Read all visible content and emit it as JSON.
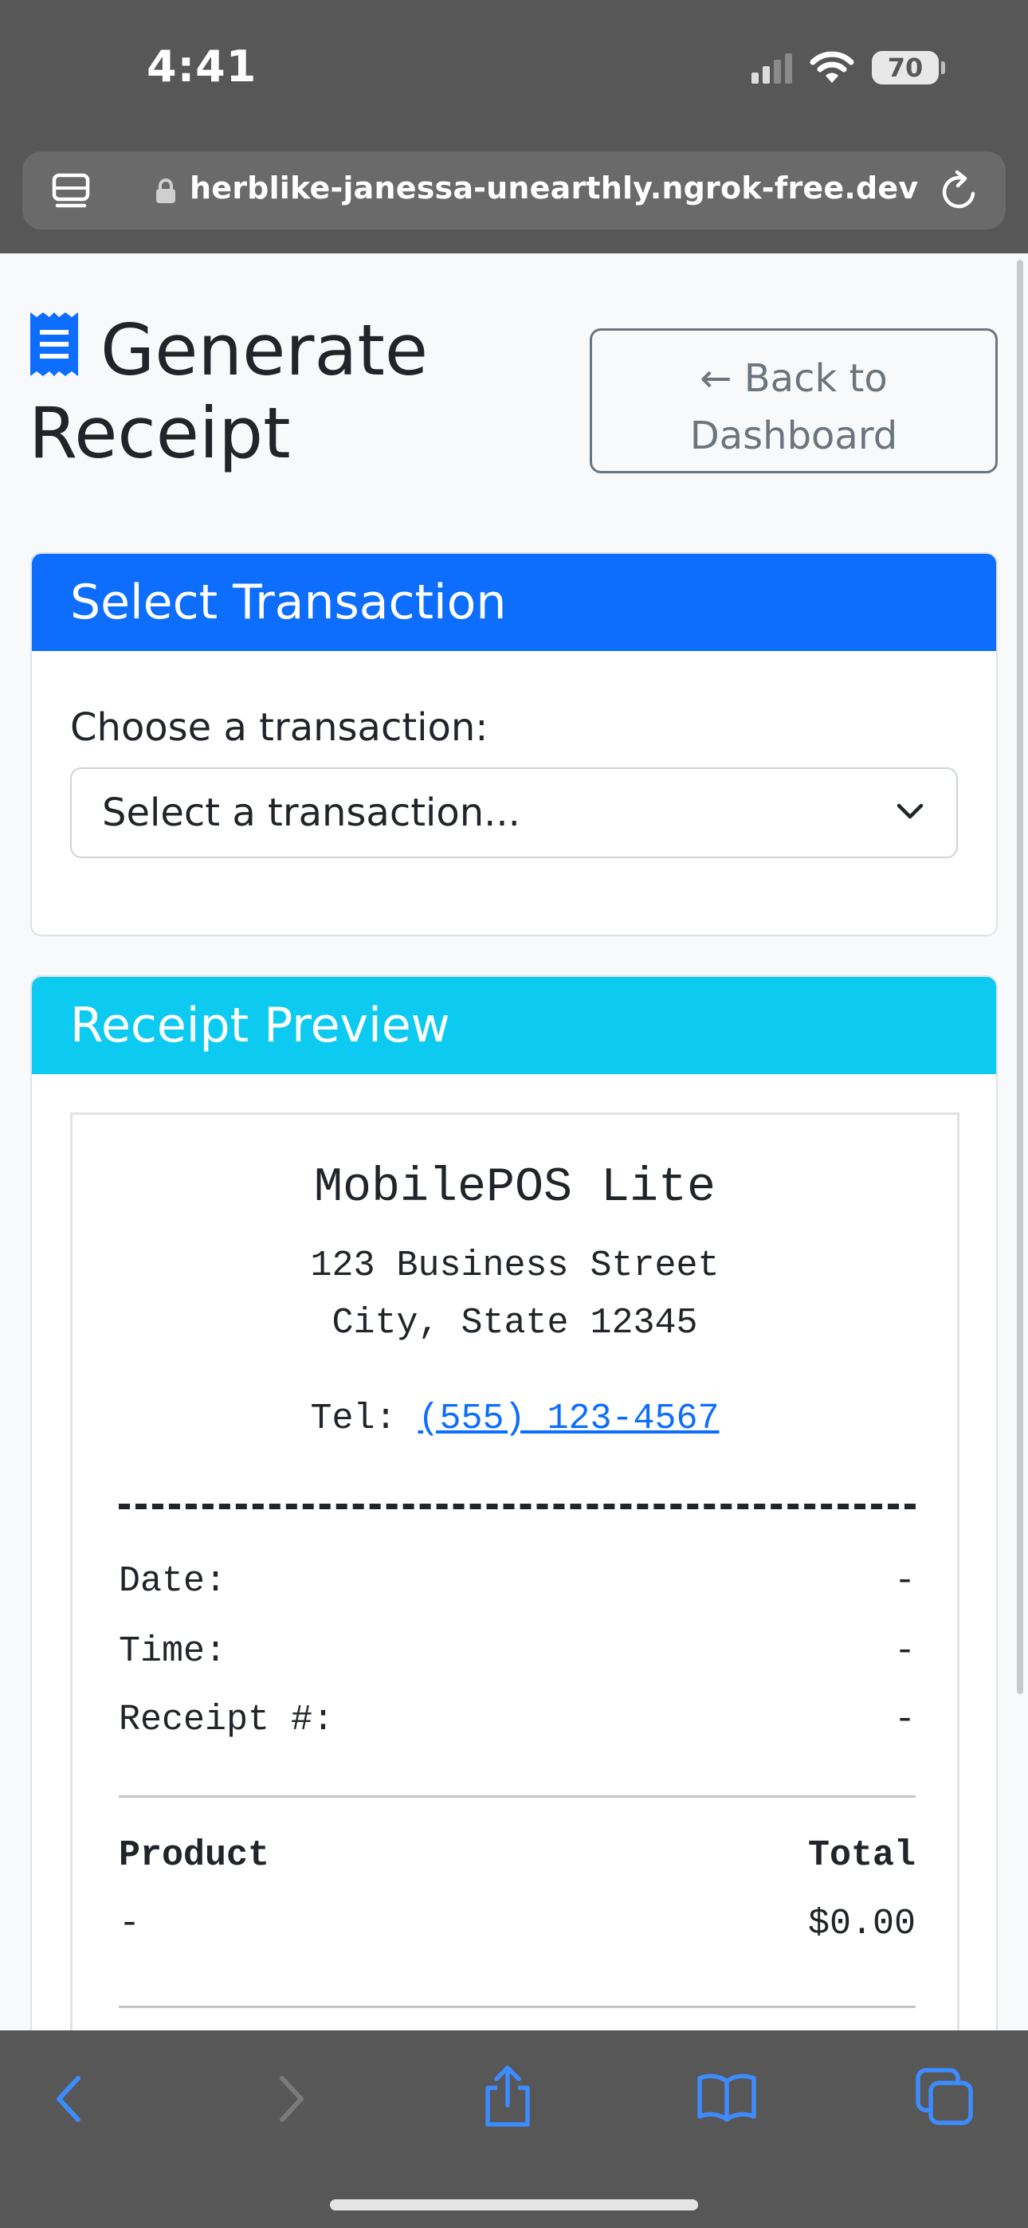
{
  "status_bar": {
    "time": "4:41",
    "battery": "70",
    "icons": [
      "cellular-signal-icon",
      "wifi-icon",
      "battery-icon"
    ]
  },
  "browser": {
    "url": "herblike-janessa-unearthly.ngrok-free.dev",
    "icons": [
      "tab-overview-icon",
      "lock-icon",
      "reload-icon"
    ]
  },
  "header": {
    "title": "Generate Receipt",
    "back_button": "← Back to Dashboard",
    "icon": "receipt-icon"
  },
  "select_card": {
    "header": "Select Transaction",
    "label": "Choose a transaction:",
    "selected": "Select a transaction..."
  },
  "preview_card": {
    "header": "Receipt Preview",
    "store_name": "MobilePOS Lite",
    "address_line1": "123 Business Street",
    "address_line2": "City, State 12345",
    "tel_label": "Tel:",
    "tel_number": "(555) 123-4567",
    "date_label": "Date:",
    "date_value": "-",
    "time_label": "Time:",
    "time_value": "-",
    "receipt_label": "Receipt #:",
    "receipt_value": "-",
    "col_product": "Product",
    "col_total": "Total",
    "item_product": "-",
    "item_total": "$0.00"
  },
  "toolbar": {
    "icons": [
      "back-icon",
      "forward-icon",
      "share-icon",
      "bookmarks-icon",
      "tabs-icon"
    ]
  },
  "colors": {
    "primary": "#0d6efd",
    "info": "#0dcaf0",
    "secondary": "#6c757d",
    "chrome": "#575757"
  }
}
